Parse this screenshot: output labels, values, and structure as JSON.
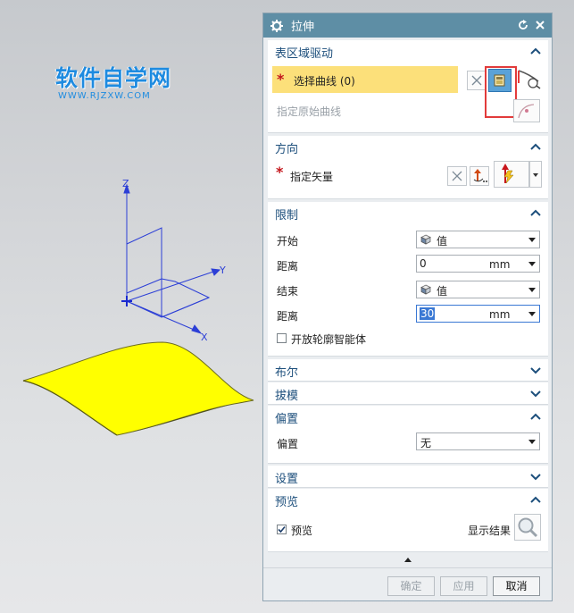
{
  "watermark": {
    "title": "软件自学网",
    "url": "WWW.RJZXW.COM"
  },
  "axes": {
    "z": "Z",
    "y": "Y",
    "x": "X"
  },
  "dialog": {
    "title": "拉伸",
    "sections": {
      "surface_drive": {
        "title": "表区域驱动",
        "select_curve": "选择曲线 (0)",
        "original_curve": "指定原始曲线"
      },
      "direction": {
        "title": "方向",
        "vector_label": "指定矢量"
      },
      "limits": {
        "title": "限制",
        "start_label": "开始",
        "start_value": "值",
        "start_distance_label": "距离",
        "start_distance": "0",
        "start_unit": "mm",
        "end_label": "结束",
        "end_value": "值",
        "end_distance_label": "距离",
        "end_distance": "30",
        "end_unit": "mm",
        "open_profile": "开放轮廓智能体",
        "open_profile_checked": false
      },
      "boolean": {
        "title": "布尔"
      },
      "draft": {
        "title": "拔模"
      },
      "offset": {
        "title": "偏置",
        "label": "偏置",
        "value": "无"
      },
      "settings": {
        "title": "设置"
      },
      "preview": {
        "title": "预览",
        "checkbox_label": "预览",
        "checked": true,
        "show_result": "显示结果"
      }
    },
    "buttons": {
      "ok": "确定",
      "apply": "应用",
      "cancel": "取消"
    }
  },
  "colors": {
    "title_bar": "#5e8ea5",
    "section_title": "#1d4f7c",
    "selection_highlight": "#fce07a",
    "annotation_box": "#e23b3b",
    "surface": "#ffff00"
  }
}
